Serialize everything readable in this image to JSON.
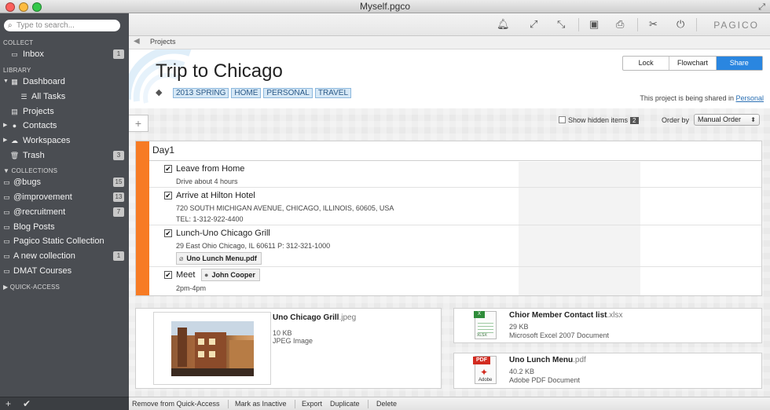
{
  "window": {
    "title": "Myself.pgco"
  },
  "sidebar": {
    "search_placeholder": "Type to search...",
    "collect_header": "COLLECT",
    "library_header": "LIBRARY",
    "collections_header": "COLLECTIONS",
    "quick_access_header": "QUICK-ACCESS",
    "inbox": {
      "label": "Inbox",
      "count": "1"
    },
    "library": [
      {
        "label": "Dashboard",
        "icon": "dashboard-icon"
      },
      {
        "label": "All Tasks",
        "icon": "list-icon"
      },
      {
        "label": "Projects",
        "icon": "projects-icon"
      },
      {
        "label": "Contacts",
        "icon": "contacts-icon"
      },
      {
        "label": "Workspaces",
        "icon": "cloud-icon"
      },
      {
        "label": "Trash",
        "icon": "trash-icon",
        "count": "3"
      }
    ],
    "collections": [
      {
        "label": "@bugs",
        "count": "15"
      },
      {
        "label": "@improvement",
        "count": "13"
      },
      {
        "label": "@recruitment",
        "count": "7"
      },
      {
        "label": "Blog Posts",
        "count": ""
      },
      {
        "label": "Pagico Static Collection",
        "count": ""
      },
      {
        "label": "A new collection",
        "count": "1"
      },
      {
        "label": "DMAT Courses",
        "count": ""
      }
    ]
  },
  "toolbar": {
    "logo": "PAGICO",
    "icons": [
      "bell-icon",
      "expand-icon",
      "collapse-icon",
      "archive-icon",
      "print-icon",
      "tools-icon",
      "power-icon"
    ]
  },
  "breadcrumb": {
    "label": "Projects"
  },
  "project": {
    "title": "Trip to Chicago",
    "tags": [
      "2013 SPRING",
      "HOME",
      "PERSONAL",
      "TRAVEL"
    ],
    "segments": {
      "lock": "Lock",
      "flowchart": "Flowchart",
      "share": "Share"
    },
    "shared_text": "This project is being shared in",
    "shared_link": "Personal"
  },
  "controls": {
    "show_hidden_label": "Show hidden items",
    "hidden_count": "2",
    "order_label": "Order by",
    "order_value": "Manual Order"
  },
  "list": {
    "title": "Day1",
    "tasks": [
      {
        "name": "Leave from Home",
        "lines": [
          "Drive about 4 hours"
        ],
        "checked": true
      },
      {
        "name": "Arrive at Hilton Hotel",
        "lines": [
          "720 SOUTH MICHIGAN AVENUE, CHICAGO, ILLINOIS, 60605, USA",
          "TEL: 1-312-922-4400"
        ],
        "checked": true
      },
      {
        "name": "Lunch-Uno Chicago Grill",
        "lines": [
          "29 East Ohio Chicago, IL 60611 P: 312-321-1000"
        ],
        "attachment": "Uno Lunch Menu.pdf",
        "checked": true
      },
      {
        "name": "Meet",
        "contact": "John Cooper",
        "lines": [
          "2pm-4pm"
        ],
        "checked": true
      }
    ]
  },
  "attachments": [
    {
      "name": "Uno Chicago Grill",
      "ext": ".jpeg",
      "size": "10 KB",
      "type": "JPEG Image"
    },
    {
      "name": "Chior Member Contact list",
      "ext": ".xlsx",
      "size": "29 KB",
      "type": "Microsoft Excel 2007 Document",
      "icon_label": "XLSX"
    },
    {
      "name": "Uno Lunch Menu",
      "ext": ".pdf",
      "size": "40.2 KB",
      "type": "Adobe PDF Document",
      "icon_label": "PDF",
      "icon_sub": "Adobe"
    }
  ],
  "bottombar": {
    "remove_quick_access": "Remove from Quick-Access",
    "mark_inactive": "Mark as Inactive",
    "export": "Export",
    "duplicate": "Duplicate",
    "delete": "Delete"
  },
  "colors": {
    "accent": "#f77b24",
    "share_blue": "#2a86e0",
    "tag_bg": "#d6e8f6",
    "sidebar_bg": "#4a4d52"
  }
}
